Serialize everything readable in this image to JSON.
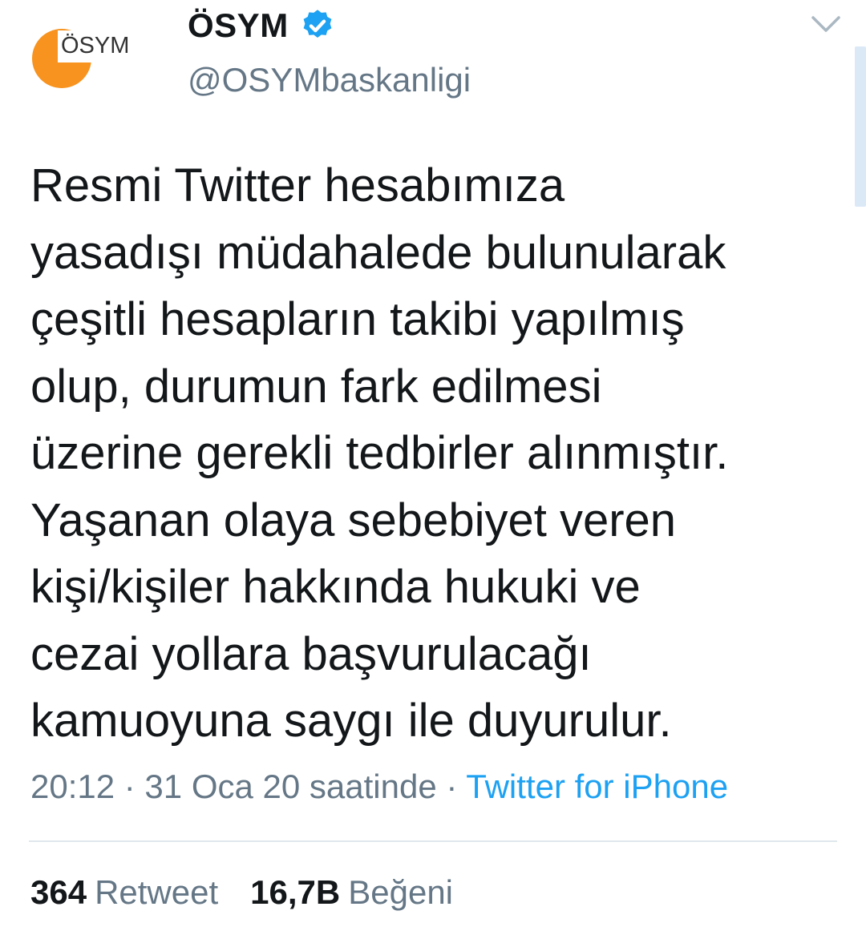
{
  "account": {
    "display_name": "ÖSYM",
    "handle": "@OSYMbaskanligi",
    "avatar_text": "ÖSYM",
    "verified": true
  },
  "tweet": {
    "lines": [
      "Resmi Twitter hesabımıza",
      "yasadışı müdahalede bulunularak",
      "çeşitli hesapların takibi yapılmış",
      "olup, durumun fark edilmesi",
      "üzerine gerekli tedbirler alınmıştır.",
      "Yaşanan olaya sebebiyet veren",
      "kişi/kişiler hakkında hukuki ve",
      "cezai yollara başvurulacağı",
      "kamuoyuna saygı ile duyurulur."
    ],
    "timestamp": "20:12 · 31 Oca 20 saatinde",
    "separator": " · ",
    "source": "Twitter for iPhone"
  },
  "stats": {
    "retweet_count": "364",
    "retweet_label": "Retweet",
    "like_count": "16,7B",
    "like_label": "Beğeni"
  },
  "icons": {
    "verified": "verified-badge-icon",
    "menu": "chevron-down-icon"
  },
  "colors": {
    "brand_orange": "#f7931e",
    "verified_blue": "#1da1f2",
    "link_blue": "#1da1f2",
    "secondary_text": "#657786"
  }
}
